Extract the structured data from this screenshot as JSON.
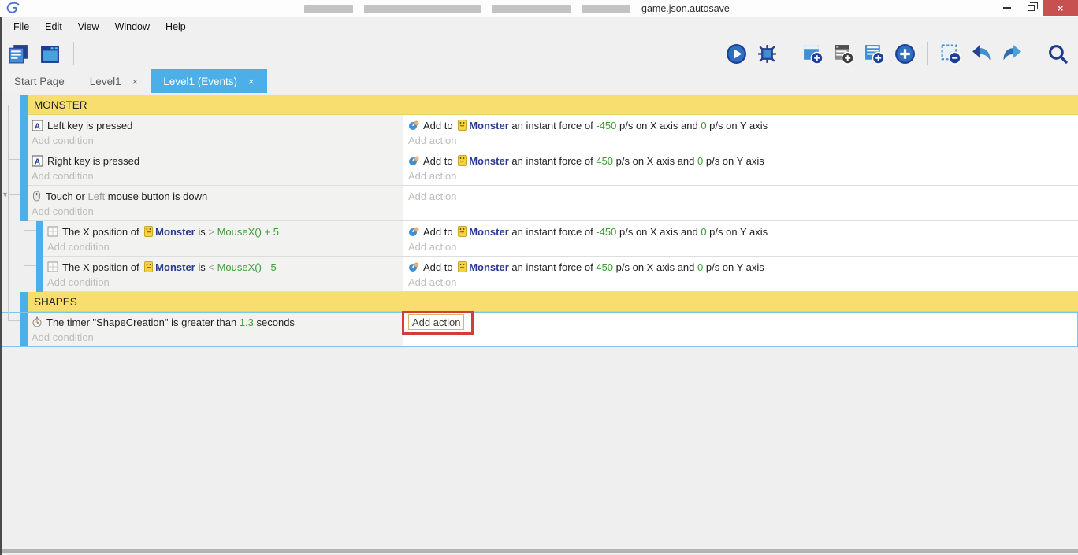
{
  "window": {
    "title": "game.json.autosave",
    "close_glyph": "×"
  },
  "menu": {
    "items": [
      "File",
      "Edit",
      "View",
      "Window",
      "Help"
    ]
  },
  "tabs": {
    "start_page": "Start Page",
    "level1": "Level1",
    "level1_events": "Level1 (Events)",
    "close_glyph": "×"
  },
  "toolbar": {
    "left_icons": [
      "project-export-icon",
      "scene-editor-icon"
    ],
    "right_icons": [
      "preview-play-icon",
      "debug-icon",
      "add-event-icon",
      "add-comment-icon",
      "add-subevent-icon",
      "add-more-icon",
      "toggle-event-icon",
      "undo-icon",
      "redo-icon",
      "search-icon"
    ]
  },
  "colors": {
    "accent_blue": "#4DAFE8",
    "group_yellow": "#F7DE6E",
    "expression_green": "#3D9B35",
    "object_navy": "#2A3B8F",
    "annotation_red": "#D23C3C"
  },
  "rows": {
    "group_monster": "MONSTER",
    "group_shapes": "SHAPES",
    "add_condition": "Add condition",
    "add_action": "Add action",
    "e1": {
      "cond": [
        "Left key is pressed"
      ],
      "act": [
        "Add to ",
        "Monster",
        " an instant force of ",
        "-450",
        " p/s on X axis and ",
        "0",
        " p/s on Y axis"
      ]
    },
    "e2": {
      "cond": [
        "Right key is pressed"
      ],
      "act": [
        "Add to ",
        "Monster",
        " an instant force of ",
        "450",
        " p/s on X axis and ",
        "0",
        " p/s on Y axis"
      ]
    },
    "e3": {
      "cond": [
        "Touch or ",
        "Left",
        " mouse button is down"
      ]
    },
    "e4": {
      "cond": [
        "The X position of ",
        "Monster",
        " is ",
        "> ",
        "MouseX() + 5"
      ],
      "act": [
        "Add to ",
        "Monster",
        " an instant force of ",
        "-450",
        " p/s on X axis and ",
        "0",
        " p/s on Y axis"
      ]
    },
    "e5": {
      "cond": [
        "The X position of ",
        "Monster",
        " is ",
        "< ",
        "MouseX() - 5"
      ],
      "act": [
        "Add to ",
        "Monster",
        " an instant force of ",
        "450",
        " p/s on X axis and ",
        "0",
        " p/s on Y axis"
      ]
    },
    "e6": {
      "cond": [
        "The timer \"ShapeCreation\" is greater than ",
        "1.3",
        " seconds"
      ]
    }
  }
}
